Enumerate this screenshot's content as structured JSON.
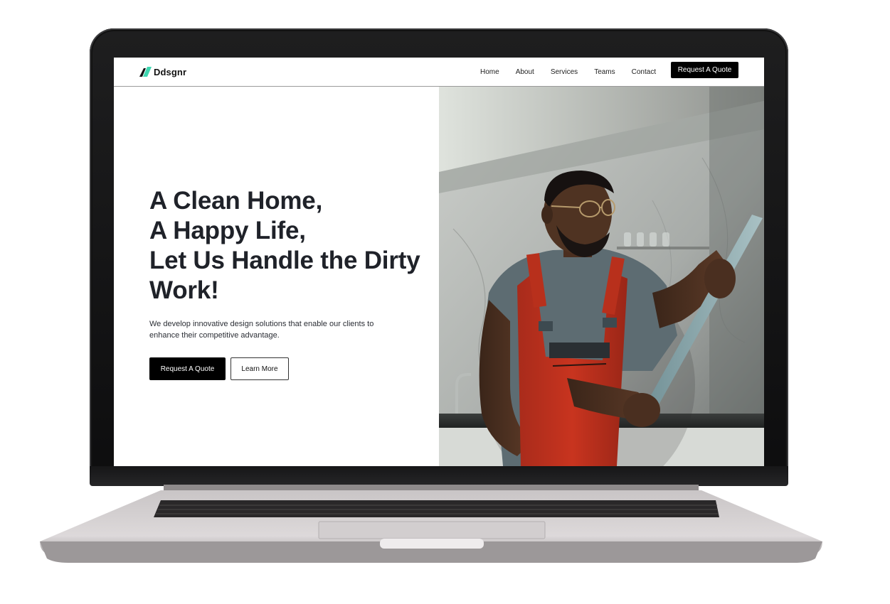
{
  "brand": {
    "name": "Ddsgnr",
    "accent": "#3ed6b0"
  },
  "nav": {
    "links": [
      "Home",
      "About",
      "Services",
      "Teams",
      "Contact"
    ],
    "cta_label": "Request A Quote"
  },
  "hero": {
    "title_lines": [
      "A Clean Home,",
      "A Happy Life,",
      "Let Us Handle the Dirty",
      "Work!"
    ],
    "subtitle": "We develop innovative design solutions that enable our clients to enhance their competitive advantage.",
    "primary_label": "Request A Quote",
    "secondary_label": "Learn More"
  },
  "colors": {
    "heading": "#1f2229",
    "button": "#000000",
    "overall_red": "#c8341f",
    "shirt": "#5d6c72"
  }
}
